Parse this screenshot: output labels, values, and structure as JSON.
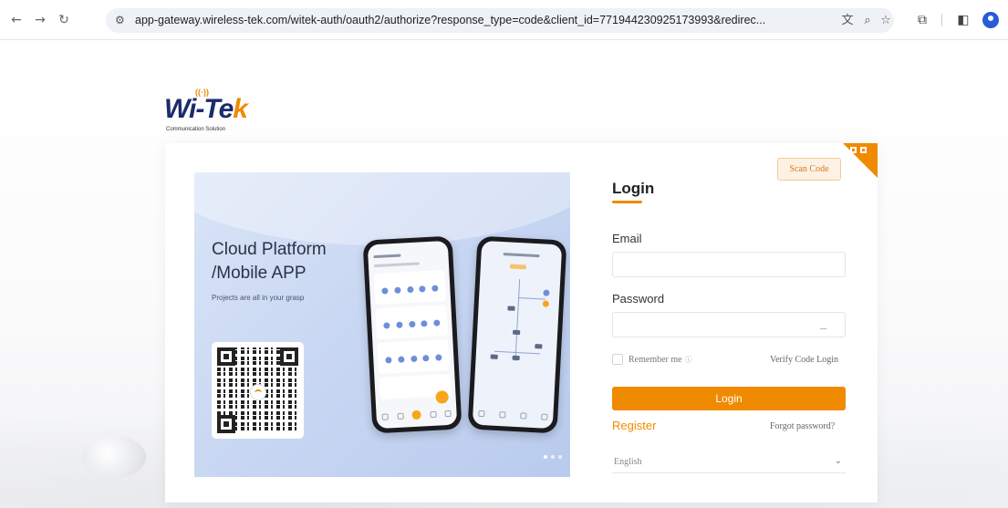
{
  "browser": {
    "url": "app-gateway.wireless-tek.com/witek-auth/oauth2/authorize?response_type=code&client_id=771944230925173993&redirec...",
    "icons": [
      "back-icon",
      "forward-icon",
      "reload-icon",
      "site-settings-icon",
      "translate-icon",
      "zoom-icon",
      "star-icon",
      "extensions-icon",
      "side-panel-icon",
      "profile-icon"
    ]
  },
  "logo": {
    "brand_prefix": "Wi-Te",
    "brand_suffix": "k",
    "tagline": "Communication Solution"
  },
  "banner": {
    "title": "Cloud Platform /Mobile APP",
    "subtitle": "Projects are all in your grasp"
  },
  "form": {
    "scan_code_label": "Scan Code",
    "title": "Login",
    "email_label": "Email",
    "email_value": "",
    "password_label": "Password",
    "password_value": "",
    "remember_label": "Remember me",
    "verify_link": "Verify Code Login",
    "login_button": "Login",
    "register_link": "Register",
    "forgot_link": "Forgot password?",
    "language": "English"
  },
  "colors": {
    "accent": "#f08a00",
    "banner_bg": "#c7d6f2",
    "brand_navy": "#1c2b6b"
  }
}
